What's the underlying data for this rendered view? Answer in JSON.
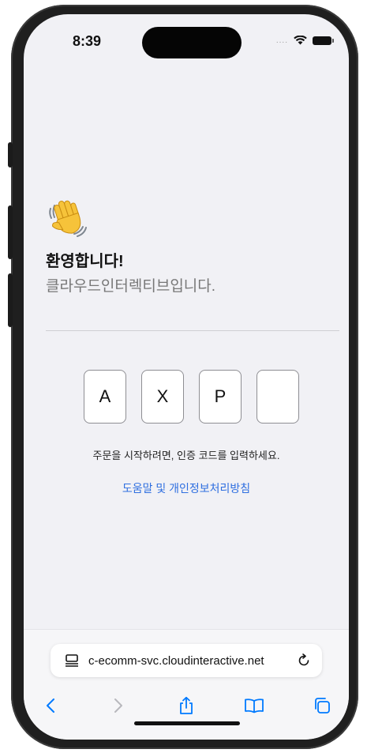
{
  "status_bar": {
    "time": "8:39",
    "signal": "....",
    "icons": [
      "wifi-icon",
      "battery-icon"
    ]
  },
  "welcome": {
    "emoji": "waving-hand-icon",
    "title": "환영합니다!",
    "subtitle": "클라우드인터렉티브입니다."
  },
  "code_entry": {
    "boxes": [
      "A",
      "X",
      "P",
      ""
    ],
    "instruction": "주문을 시작하려면, 인증 코드를 입력하세요."
  },
  "help_link": "도움말 및 개인정보처리방침",
  "browser": {
    "url": "c-ecomm-svc.cloudinteractive.net",
    "toolbar": [
      "back-icon",
      "forward-icon",
      "share-icon",
      "bookmarks-icon",
      "tabs-icon"
    ]
  },
  "colors": {
    "screen_background": "#f1f1f5",
    "link": "#2f6fe0",
    "ios_blue": "#007aff",
    "disabled": "#b8b8bd",
    "box_border": "#8e8e93"
  }
}
